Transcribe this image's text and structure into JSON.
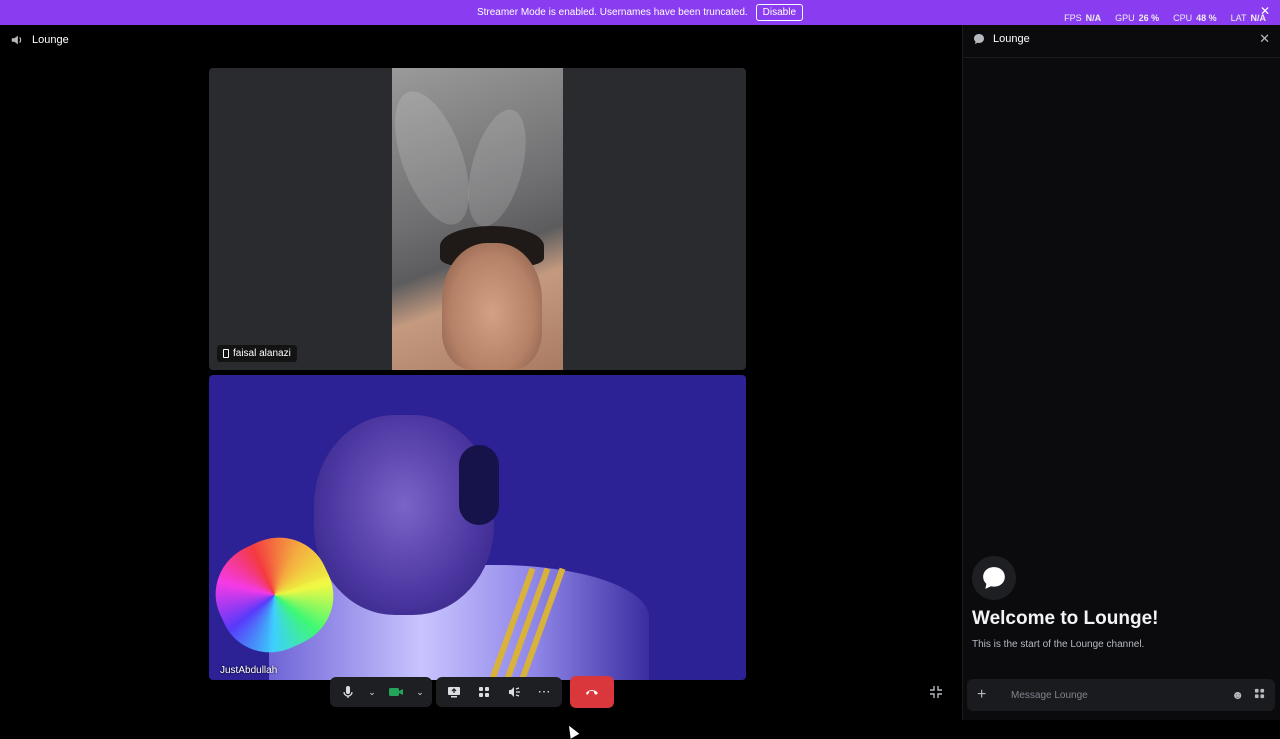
{
  "banner": {
    "message": "Streamer Mode is enabled. Usernames have been truncated.",
    "disable_label": "Disable",
    "stats": [
      {
        "label": "FPS",
        "value": "N/A"
      },
      {
        "label": "GPU",
        "value": "26 %"
      },
      {
        "label": "CPU",
        "value": "48 %"
      },
      {
        "label": "LAT",
        "value": "N/A"
      }
    ]
  },
  "voice": {
    "channel_name": "Lounge",
    "participants": [
      {
        "name": "faisal alanazi",
        "device": "phone-icon"
      },
      {
        "name": "JustAbdullah"
      }
    ],
    "controls": [
      {
        "icon": "microphone-icon"
      },
      {
        "icon": "chevron-down-icon"
      },
      {
        "icon": "camera-icon",
        "state": "on",
        "color": "#23a55a"
      },
      {
        "icon": "chevron-down-icon"
      },
      {
        "icon": "screen-share-icon"
      },
      {
        "icon": "activities-icon"
      },
      {
        "icon": "soundboard-icon"
      },
      {
        "icon": "more-icon"
      },
      {
        "icon": "hang-up-icon",
        "color": "#da373c"
      }
    ]
  },
  "chat": {
    "channel_name": "Lounge",
    "welcome_title": "Welcome to Lounge!",
    "welcome_subtitle": "This is the start of the Lounge channel.",
    "message_placeholder": "Message Lounge"
  },
  "colors": {
    "banner_bg": "#8a3df0",
    "hangup": "#da373c",
    "camera_on": "#23a55a"
  }
}
